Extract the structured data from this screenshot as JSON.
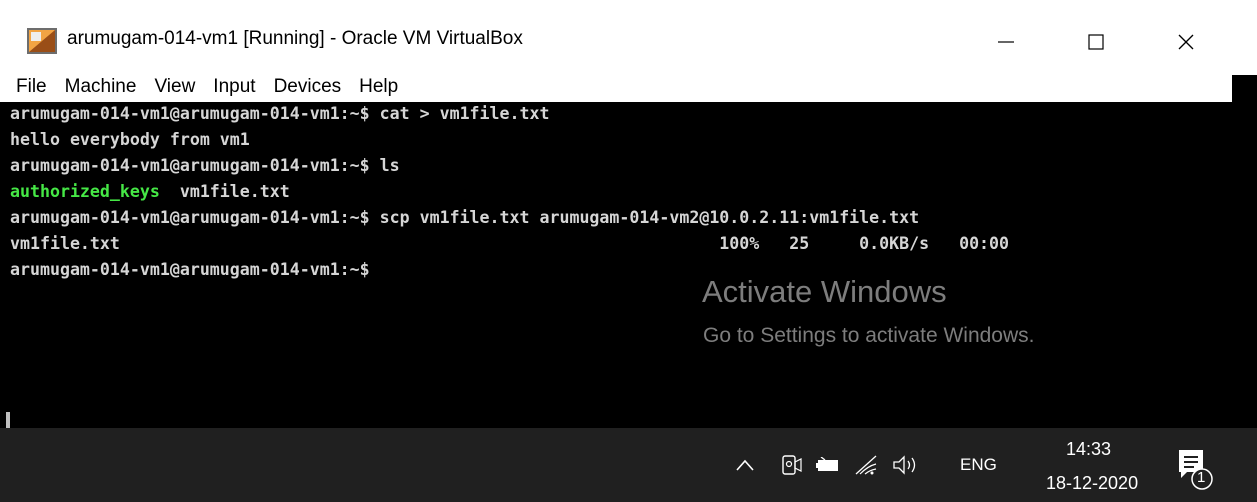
{
  "window": {
    "title": "arumugam-014-vm1 [Running] - Oracle VM VirtualBox",
    "minimize_glyph": "—",
    "close_glyph": "✕"
  },
  "menu": {
    "items": [
      "File",
      "Machine",
      "View",
      "Input",
      "Devices",
      "Help"
    ]
  },
  "terminal": {
    "lines": [
      {
        "text": "arumugam-014-vm1@arumugam-014-vm1:~$ cat > vm1file.txt"
      },
      {
        "text": "hello everybody from vm1"
      },
      {
        "text": "arumugam-014-vm1@arumugam-014-vm1:~$ ls"
      },
      {
        "green": "authorized_keys",
        "text": "  vm1file.txt"
      },
      {
        "text": "arumugam-014-vm1@arumugam-014-vm1:~$ scp vm1file.txt arumugam-014-vm2@10.0.2.11:vm1file.txt"
      },
      {
        "text": "vm1file.txt                                                            100%   25     0.0KB/s   00:00"
      },
      {
        "text": "arumugam-014-vm1@arumugam-014-vm1:~$"
      }
    ]
  },
  "watermark": {
    "title": "Activate Windows",
    "subtitle": "Go to Settings to activate Windows."
  },
  "taskbar": {
    "language": "ENG",
    "time": "14:33",
    "date": "18-12-2020",
    "notification_count": "1",
    "icons": [
      "chevron-up-icon",
      "meet-now-icon",
      "battery-icon",
      "wifi-icon",
      "volume-icon",
      "notification-icon"
    ]
  },
  "colors": {
    "terminal_bg": "#000000",
    "terminal_text": "#d6d6d6",
    "terminal_green": "#46e846",
    "taskbar_bg": "#202020",
    "watermark": "#7d7d7d"
  }
}
